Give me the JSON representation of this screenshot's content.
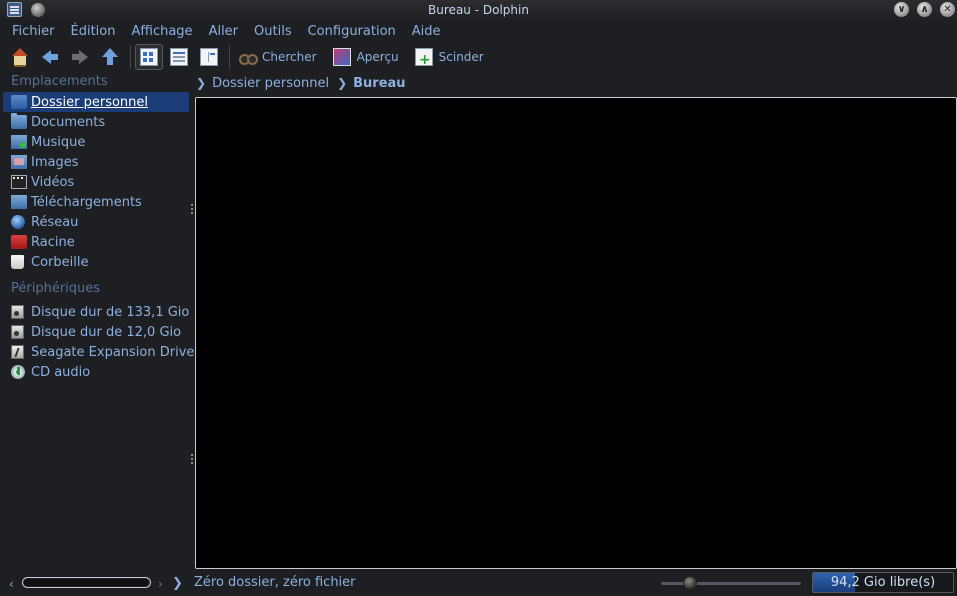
{
  "window": {
    "title": "Bureau - Dolphin",
    "buttons": [
      "minimize",
      "maximize",
      "close"
    ]
  },
  "menubar": {
    "items": [
      {
        "label": "Fichier"
      },
      {
        "label": "Édition"
      },
      {
        "label": "Affichage"
      },
      {
        "label": "Aller"
      },
      {
        "label": "Outils"
      },
      {
        "label": "Configuration"
      },
      {
        "label": "Aide"
      }
    ]
  },
  "toolbar": {
    "search_label": "Chercher",
    "preview_label": "Aperçu",
    "split_label": "Scinder",
    "icons": [
      "home-icon",
      "back-arrow-icon",
      "forward-arrow-icon",
      "up-arrow-icon",
      "icons-view-icon",
      "details-view-icon",
      "columns-view-icon",
      "binoculars-icon",
      "preview-icon",
      "split-icon"
    ]
  },
  "places": {
    "section_places": "Emplacements",
    "items": [
      {
        "label": "Dossier personnel",
        "icon": "home-folder-icon",
        "selected": true
      },
      {
        "label": "Documents",
        "icon": "documents-folder-icon"
      },
      {
        "label": "Musique",
        "icon": "music-folder-icon"
      },
      {
        "label": "Images",
        "icon": "images-folder-icon"
      },
      {
        "label": "Vidéos",
        "icon": "video-folder-icon"
      },
      {
        "label": "Téléchargements",
        "icon": "downloads-folder-icon"
      },
      {
        "label": "Réseau",
        "icon": "network-globe-icon"
      },
      {
        "label": "Racine",
        "icon": "root-folder-icon"
      },
      {
        "label": "Corbeille",
        "icon": "trash-icon"
      }
    ],
    "section_devices": "Périphériques",
    "devices": [
      {
        "label": "Disque dur de 133,1 Gio",
        "icon": "hard-disk-icon"
      },
      {
        "label": "Disque dur de 12,0 Gio",
        "icon": "hard-disk-icon"
      },
      {
        "label": "Seagate Expansion Drive",
        "icon": "usb-drive-icon"
      },
      {
        "label": "CD audio",
        "icon": "audio-cd-icon"
      }
    ]
  },
  "breadcrumb": {
    "items": [
      "Dossier personnel",
      "Bureau"
    ]
  },
  "statusbar": {
    "text": "Zéro dossier, zéro fichier",
    "free_space": "94,2 Gio libre(s)",
    "free_space_fraction": 0.3,
    "zoom_level_fraction": 0.2
  },
  "colors": {
    "accent": "#1a3d78",
    "text": "#8cb0e0",
    "background": "#1e1f22",
    "view_background": "#000000"
  }
}
